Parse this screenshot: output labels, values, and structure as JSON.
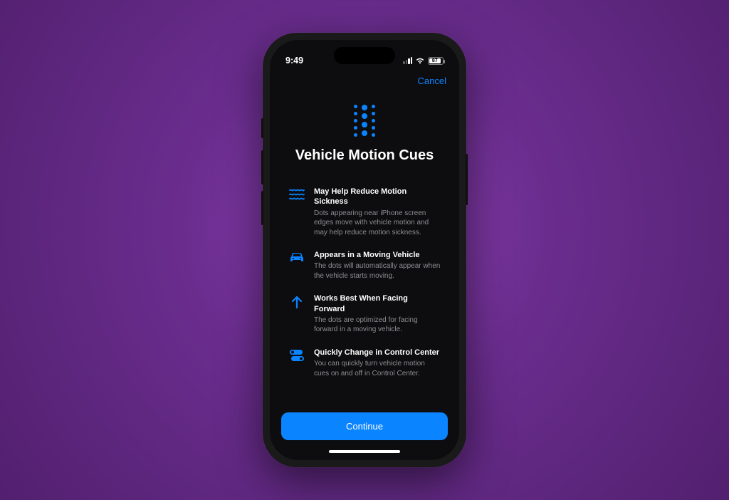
{
  "status": {
    "time": "9:49",
    "battery_pct": "87"
  },
  "nav": {
    "cancel": "Cancel"
  },
  "title": "Vehicle Motion Cues",
  "features": [
    {
      "title": "May Help Reduce Motion Sickness",
      "desc": "Dots appearing near iPhone screen edges move with vehicle motion and may help reduce motion sickness."
    },
    {
      "title": "Appears in a Moving Vehicle",
      "desc": "The dots will automatically appear when the vehicle starts moving."
    },
    {
      "title": "Works Best When Facing Forward",
      "desc": "The dots are optimized for facing forward in a moving vehicle."
    },
    {
      "title": "Quickly Change in Control Center",
      "desc": "You can quickly turn vehicle motion cues on and off in Control Center."
    }
  ],
  "footer": {
    "continue": "Continue"
  }
}
